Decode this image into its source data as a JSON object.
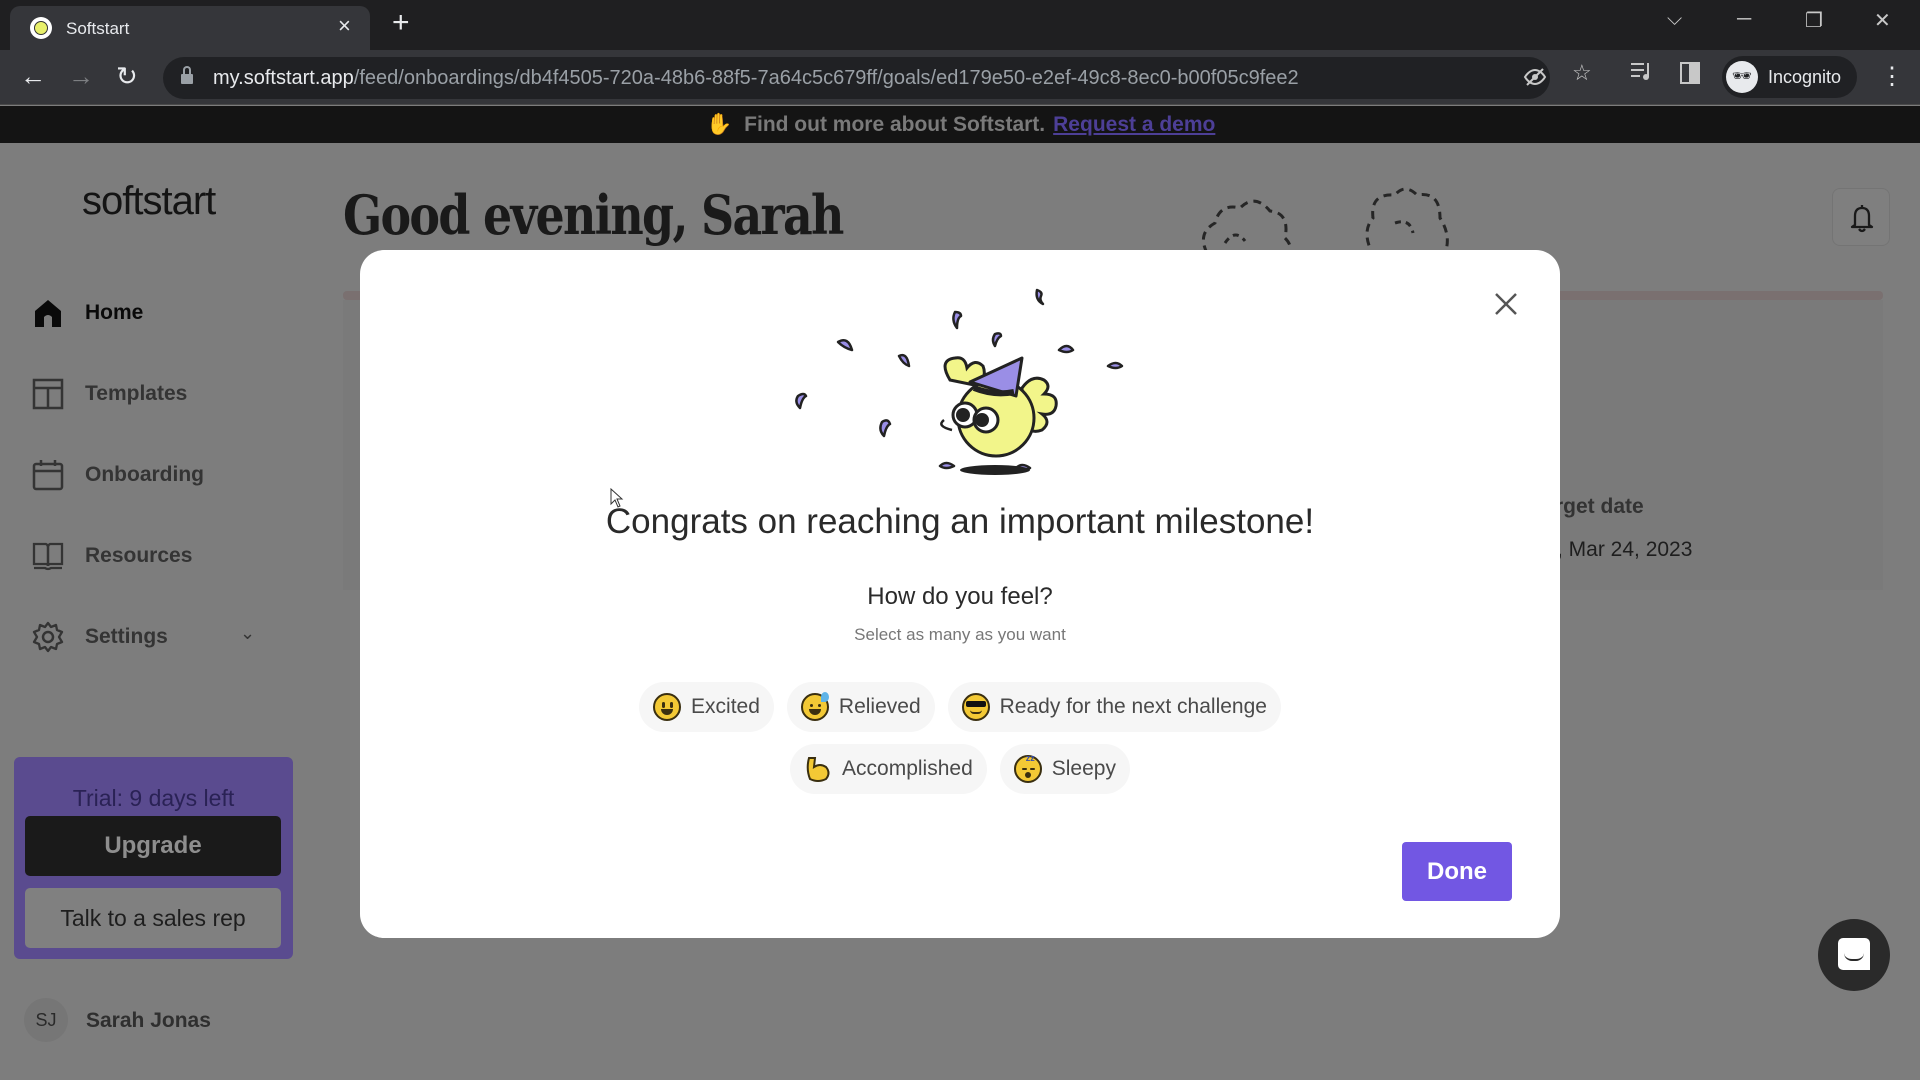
{
  "browser": {
    "tab_title": "Softstart",
    "tab_close": "×",
    "new_tab": "+",
    "url_host": "my.softstart.app",
    "url_path": "/feed/onboardings/db4f4505-720a-48b6-88f5-7a64c5c679ff/goals/ed179e50-e2ef-49c8-8ec0-b00f05c9fee2",
    "profile_label": "Incognito",
    "controls": {
      "tab_search": "⌵",
      "minimize": "─",
      "restore": "❐",
      "close": "✕"
    }
  },
  "banner": {
    "text": "Find out more about Softstart.",
    "link": "Request a demo"
  },
  "sidebar": {
    "logo": "softstart",
    "items": [
      {
        "label": "Home",
        "icon": "home-icon",
        "active": true
      },
      {
        "label": "Templates",
        "icon": "templates-icon"
      },
      {
        "label": "Onboarding",
        "icon": "calendar-icon"
      },
      {
        "label": "Resources",
        "icon": "book-icon"
      },
      {
        "label": "Settings",
        "icon": "gear-icon",
        "expandable": true
      }
    ],
    "trial": {
      "text": "Trial: 9 days left",
      "upgrade": "Upgrade",
      "sales": "Talk to a sales rep"
    },
    "user": {
      "initials": "SJ",
      "name": "Sarah Jonas"
    }
  },
  "main": {
    "greeting": "Good evening, Sarah",
    "target_label": "rget date",
    "target_date": ", Mar 24, 2023"
  },
  "modal": {
    "title": "Congrats on reaching an important milestone!",
    "question": "How do you feel?",
    "hint": "Select as many as you want",
    "feelings": [
      {
        "label": "Excited",
        "emoji": "grinning-face"
      },
      {
        "label": "Relieved",
        "emoji": "grinning-sweat-face"
      },
      {
        "label": "Ready for the next challenge",
        "emoji": "sunglasses-face"
      },
      {
        "label": "Accomplished",
        "emoji": "flexed-biceps"
      },
      {
        "label": "Sleepy",
        "emoji": "sleeping-face"
      }
    ],
    "done": "Done"
  },
  "colors": {
    "accent": "#7257e3",
    "trial_bg": "#5a4b8f",
    "overlay": "#7d7d7d"
  }
}
